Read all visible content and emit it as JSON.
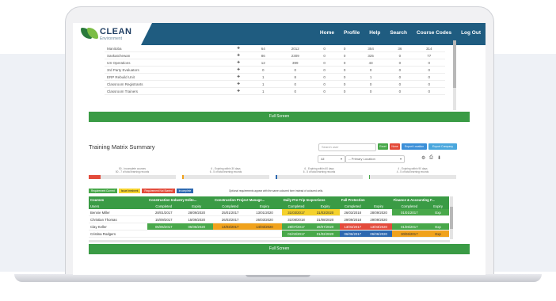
{
  "nav": {
    "logo": "CLEAN",
    "logo_sub": "Environment",
    "links": [
      "Home",
      "Profile",
      "Help",
      "Search",
      "Course Codes",
      "Log Out"
    ]
  },
  "top_table": {
    "rows": [
      {
        "name": "Manitoba",
        "v1": "64",
        "v2": "2012",
        "v3": "0",
        "v4": "0",
        "v5": "354",
        "v6": "36",
        "v7": "314"
      },
      {
        "name": "Saskatchewan",
        "v1": "86",
        "v2": "2309",
        "v3": "0",
        "v4": "0",
        "v5": "325",
        "v6": "0",
        "v7": "77"
      },
      {
        "name": "US Operations",
        "v1": "12",
        "v2": "399",
        "v3": "0",
        "v4": "0",
        "v5": "43",
        "v6": "0",
        "v7": "0"
      },
      {
        "name": "3rd Party Evaluators",
        "v1": "0",
        "v2": "0",
        "v3": "0",
        "v4": "0",
        "v5": "0",
        "v6": "0",
        "v7": "0"
      },
      {
        "name": "ERP Rebuild Unit",
        "v1": "1",
        "v2": "8",
        "v3": "0",
        "v4": "0",
        "v5": "1",
        "v6": "0",
        "v7": "0"
      },
      {
        "name": "Classroom Registrants",
        "v1": "1",
        "v2": "0",
        "v3": "0",
        "v4": "0",
        "v5": "0",
        "v6": "0",
        "v7": "0"
      },
      {
        "name": "Classroom Trainers",
        "v1": "1",
        "v2": "0",
        "v3": "0",
        "v4": "0",
        "v5": "0",
        "v6": "0",
        "v7": "0"
      }
    ],
    "full_screen": "Full Screen"
  },
  "matrix": {
    "title": "Training Matrix Summary",
    "search_placeholder": "Search user",
    "buttons": [
      "Excel",
      "None",
      "Export Location",
      "Export Company"
    ],
    "button_colors": [
      "#48a84a",
      "#e34b3b",
      "#3b8fd8",
      "#4aa7dd"
    ],
    "filter1": "All",
    "filter2": "-- Primary Location",
    "progress": [
      {
        "line1": "50 - Incomplete courses",
        "line2": "50 - 7 of total learning records",
        "pct": 0.14,
        "color": "#e34b3b"
      },
      {
        "line1": "6 - Expiring within 30 days",
        "line2": "6 - 5 of total learning records",
        "pct": 0.02,
        "color": "#f0a21c"
      },
      {
        "line1": "6 - Expiring within 60 days",
        "line2": "6 - 5 of total learning records",
        "pct": 0.02,
        "color": "#2c68b0"
      },
      {
        "line1": "4 - Expiring within 90 days",
        "line2": "4 - 5 of total learning records",
        "pct": 0.01,
        "color": "#48a84a"
      }
    ],
    "legend": [
      {
        "label": "Requirement Current",
        "color": "#48a84a"
      },
      {
        "label": "Issue Imminent",
        "color": "#f5d22c"
      },
      {
        "label": "Requirement Not Started",
        "color": "#e34b3b"
      },
      {
        "label": "Incomplete",
        "color": "#2c68b0"
      }
    ],
    "legend_note": "Optional requirements appear with the same coloured form instead of coloured cells.",
    "courses_label": "Courses",
    "users_label": "Users",
    "courses": [
      "Construction Industry Edito...",
      "Construction Project Manage...",
      "Daily Pre-Trip Inspections",
      "Fall Protection",
      "Finance & Accounting F..."
    ],
    "sub_completed": "Completed",
    "sub_expiry": "Expiry",
    "rows": [
      {
        "name": "Bennie Miller",
        "cells": [
          [
            "28/01/2017",
            ""
          ],
          [
            "28/09/2020",
            ""
          ],
          [
            "25/01/2017",
            ""
          ],
          [
            "13/01/2020",
            ""
          ],
          [
            "31/03/2017",
            "c-yellow"
          ],
          [
            "31/03/2020",
            "c-yellow"
          ],
          [
            "26/03/2018",
            ""
          ],
          [
            "28/09/2020",
            ""
          ],
          [
            "01/01/2017",
            "c-green"
          ],
          [
            "Exp",
            "c-green"
          ]
        ]
      },
      {
        "name": "Christian Thomas",
        "cells": [
          [
            "15/09/2017",
            ""
          ],
          [
            "15/09/2020",
            ""
          ],
          [
            "26/03/2017",
            ""
          ],
          [
            "26/03/2020",
            ""
          ],
          [
            "31/08/2018",
            ""
          ],
          [
            "31/08/2020",
            ""
          ],
          [
            "29/09/2018",
            ""
          ],
          [
            "29/09/2020",
            ""
          ],
          [
            "",
            ""
          ],
          [
            "",
            ""
          ]
        ]
      },
      {
        "name": "Clay Keller",
        "cells": [
          [
            "05/05/2017",
            "c-green"
          ],
          [
            "05/05/2020",
            "c-green"
          ],
          [
            "14/03/2017",
            "c-orange"
          ],
          [
            "14/03/2020",
            "c-orange"
          ],
          [
            "28/07/2017",
            "c-green"
          ],
          [
            "28/07/2020",
            "c-green"
          ],
          [
            "13/03/2017",
            "c-red"
          ],
          [
            "13/03/2020",
            "c-red"
          ],
          [
            "01/06/2017",
            "c-green"
          ],
          [
            "Exp",
            "c-green"
          ]
        ]
      },
      {
        "name": "Cristina Rodgers",
        "cells": [
          [
            "",
            ""
          ],
          [
            "",
            ""
          ],
          [
            "",
            ""
          ],
          [
            "",
            ""
          ],
          [
            "01/02/2017",
            "c-green"
          ],
          [
            "01/02/2020",
            "c-green"
          ],
          [
            "06/06/2017",
            "c-blue"
          ],
          [
            "06/06/2020",
            "c-blue"
          ],
          [
            "30/06/2017",
            "c-orange"
          ],
          [
            "Exp",
            "c-orange"
          ]
        ]
      }
    ],
    "full_screen": "Full Screen"
  }
}
